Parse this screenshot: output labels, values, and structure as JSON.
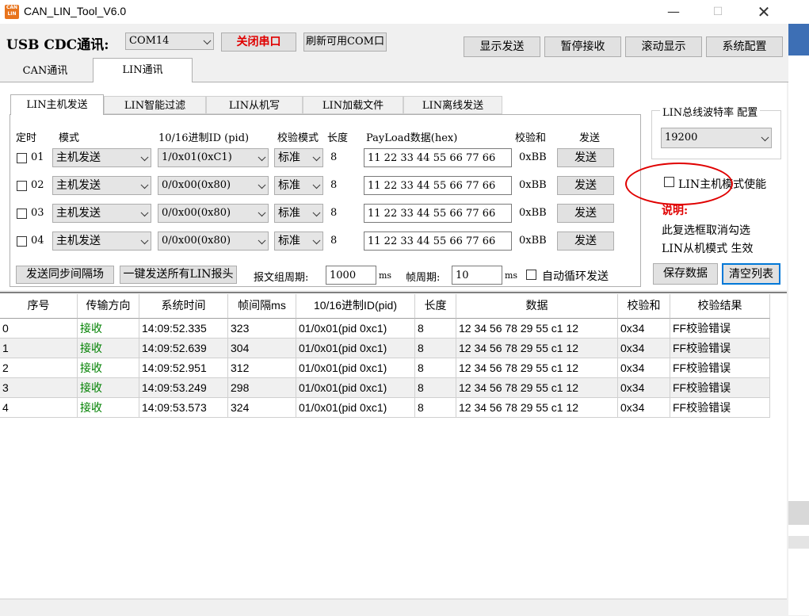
{
  "window": {
    "title": "CAN_LIN_Tool_V6.0",
    "icon_text": "CAN LIN"
  },
  "toolbar": {
    "usb_label": "USB CDC通讯:",
    "com_port": "COM14",
    "close_port": "关闭串口",
    "refresh_com": "刷新可用COM口",
    "show_send": "显示发送",
    "pause_recv": "暂停接收",
    "scroll_show": "滚动显示",
    "sys_config": "系统配置"
  },
  "main_tabs": [
    "CAN通讯",
    "LIN通讯"
  ],
  "sub_tabs": [
    "LIN主机发送",
    "LIN智能过滤",
    "LIN从机写",
    "LIN加载文件",
    "LIN离线发送"
  ],
  "form_headers": {
    "timer": "定时",
    "mode": "模式",
    "id": "10/16进制ID (pid)",
    "check_mode": "校验模式",
    "length": "长度",
    "payload": "PayLoad数据(hex)",
    "checksum": "校验和",
    "send": "发送"
  },
  "send_rows": [
    {
      "num": "01",
      "mode": "主机发送",
      "id": "1/0x01(0xC1)",
      "check": "标准",
      "len": "8",
      "payload": "11 22 33 44 55 66 77 66",
      "checksum": "0xBB",
      "send": "发送"
    },
    {
      "num": "02",
      "mode": "主机发送",
      "id": "0/0x00(0x80)",
      "check": "标准",
      "len": "8",
      "payload": "11 22 33 44 55 66 77 66",
      "checksum": "0xBB",
      "send": "发送"
    },
    {
      "num": "03",
      "mode": "主机发送",
      "id": "0/0x00(0x80)",
      "check": "标准",
      "len": "8",
      "payload": "11 22 33 44 55 66 77 66",
      "checksum": "0xBB",
      "send": "发送"
    },
    {
      "num": "04",
      "mode": "主机发送",
      "id": "0/0x00(0x80)",
      "check": "标准",
      "len": "8",
      "payload": "11 22 33 44 55 66 77 66",
      "checksum": "0xBB",
      "send": "发送"
    }
  ],
  "bottom_controls": {
    "sync_gap": "发送同步间隔场",
    "send_all": "一键发送所有LIN报头",
    "group_period_label": "报文组周期:",
    "group_period": "1000",
    "ms1": "ms",
    "frame_period_label": "帧周期:",
    "frame_period": "10",
    "ms2": "ms",
    "auto_loop": "自动循环发送"
  },
  "right_panel": {
    "baud_title": "LIN总线波特率 配置",
    "baud_value": "19200",
    "master_enable": "LIN主机模式使能",
    "note_title": "说明:",
    "note_line1": "此复选框取消勾选",
    "note_line2": "LIN从机模式 生效",
    "save_data": "保存数据",
    "clear_list": "清空列表"
  },
  "table": {
    "columns": [
      "序号",
      "传输方向",
      "系统时间",
      "帧间隔ms",
      "10/16进制ID(pid)",
      "长度",
      "数据",
      "校验和",
      "校验结果"
    ],
    "rows": [
      [
        "0",
        "接收",
        "14:09:52.335",
        "323",
        "01/0x01(pid 0xc1)",
        "8",
        "12 34 56 78 29 55 c1 12",
        "0x34",
        "FF校验错误"
      ],
      [
        "1",
        "接收",
        "14:09:52.639",
        "304",
        "01/0x01(pid 0xc1)",
        "8",
        "12 34 56 78 29 55 c1 12",
        "0x34",
        "FF校验错误"
      ],
      [
        "2",
        "接收",
        "14:09:52.951",
        "312",
        "01/0x01(pid 0xc1)",
        "8",
        "12 34 56 78 29 55 c1 12",
        "0x34",
        "FF校验错误"
      ],
      [
        "3",
        "接收",
        "14:09:53.249",
        "298",
        "01/0x01(pid 0xc1)",
        "8",
        "12 34 56 78 29 55 c1 12",
        "0x34",
        "FF校验错误"
      ],
      [
        "4",
        "接收",
        "14:09:53.573",
        "324",
        "01/0x01(pid 0xc1)",
        "8",
        "12 34 56 78 29 55 c1 12",
        "0x34",
        "FF校验错误"
      ]
    ]
  },
  "colors": {
    "red_text": "#e00000",
    "green_text": "#008000",
    "annotation_circle": "#e00000"
  }
}
